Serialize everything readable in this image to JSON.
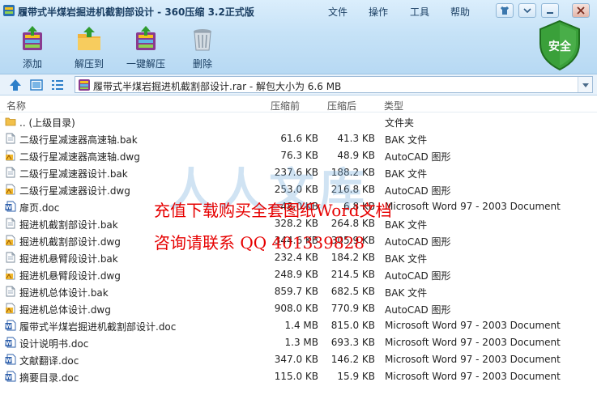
{
  "window": {
    "title": "履带式半煤岩掘进机截割部设计 - 360压缩 3.2正式版",
    "menu": [
      "文件",
      "操作",
      "工具",
      "帮助"
    ]
  },
  "toolbar": {
    "add": "添加",
    "extract_to": "解压到",
    "one_click": "一键解压",
    "delete": "删除"
  },
  "security_badge": "安全",
  "address": "履带式半煤岩掘进机截割部设计.rar - 解包大小为 6.6 MB",
  "columns": {
    "name": "名称",
    "orig": "压缩前",
    "comp": "压缩后",
    "type": "类型"
  },
  "rows": [
    {
      "name": ".. (上级目录)",
      "orig": "",
      "comp": "",
      "type": "文件夹",
      "icon": "folder-icon"
    },
    {
      "name": "二级行星减速器高速轴.bak",
      "orig": "61.6 KB",
      "comp": "41.3 KB",
      "type": "BAK 文件",
      "icon": "file-icon"
    },
    {
      "name": "二级行星减速器高速轴.dwg",
      "orig": "76.3 KB",
      "comp": "48.9 KB",
      "type": "AutoCAD 图形",
      "icon": "dwg-icon"
    },
    {
      "name": "二级行星减速器设计.bak",
      "orig": "237.6 KB",
      "comp": "188.2 KB",
      "type": "BAK 文件",
      "icon": "file-icon"
    },
    {
      "name": "二级行星减速器设计.dwg",
      "orig": "253.0 KB",
      "comp": "216.8 KB",
      "type": "AutoCAD 图形",
      "icon": "dwg-icon"
    },
    {
      "name": "扉页.doc",
      "orig": "48.0 KB",
      "comp": "6.8 KB",
      "type": "Microsoft Word 97 - 2003 Document",
      "icon": "doc-icon"
    },
    {
      "name": "掘进机截割部设计.bak",
      "orig": "328.2 KB",
      "comp": "264.8 KB",
      "type": "BAK 文件",
      "icon": "file-icon"
    },
    {
      "name": "掘进机截割部设计.dwg",
      "orig": "344.6 KB",
      "comp": "305.9 KB",
      "type": "AutoCAD 图形",
      "icon": "dwg-icon"
    },
    {
      "name": "掘进机悬臂段设计.bak",
      "orig": "232.4 KB",
      "comp": "184.2 KB",
      "type": "BAK 文件",
      "icon": "file-icon"
    },
    {
      "name": "掘进机悬臂段设计.dwg",
      "orig": "248.9 KB",
      "comp": "214.5 KB",
      "type": "AutoCAD 图形",
      "icon": "dwg-icon"
    },
    {
      "name": "掘进机总体设计.bak",
      "orig": "859.7 KB",
      "comp": "682.5 KB",
      "type": "BAK 文件",
      "icon": "file-icon"
    },
    {
      "name": "掘进机总体设计.dwg",
      "orig": "908.0 KB",
      "comp": "770.9 KB",
      "type": "AutoCAD 图形",
      "icon": "dwg-icon"
    },
    {
      "name": "履带式半煤岩掘进机截割部设计.doc",
      "orig": "1.4 MB",
      "comp": "815.0 KB",
      "type": "Microsoft Word 97 - 2003 Document",
      "icon": "doc-icon"
    },
    {
      "name": "设计说明书.doc",
      "orig": "1.3 MB",
      "comp": "693.3 KB",
      "type": "Microsoft Word 97 - 2003 Document",
      "icon": "doc-icon"
    },
    {
      "name": "文献翻译.doc",
      "orig": "347.0 KB",
      "comp": "146.2 KB",
      "type": "Microsoft Word 97 - 2003 Document",
      "icon": "doc-icon"
    },
    {
      "name": "摘要目录.doc",
      "orig": "115.0 KB",
      "comp": "15.9 KB",
      "type": "Microsoft Word 97 - 2003 Document",
      "icon": "doc-icon"
    }
  ],
  "watermark": {
    "line1": "充值下载购买全套图纸Word文档",
    "line2": "咨询请联系 QQ 401339828"
  },
  "colors": {
    "watermark": "#e60000",
    "titlebar": "#c6e2f7",
    "shield": "#3aa03a"
  }
}
